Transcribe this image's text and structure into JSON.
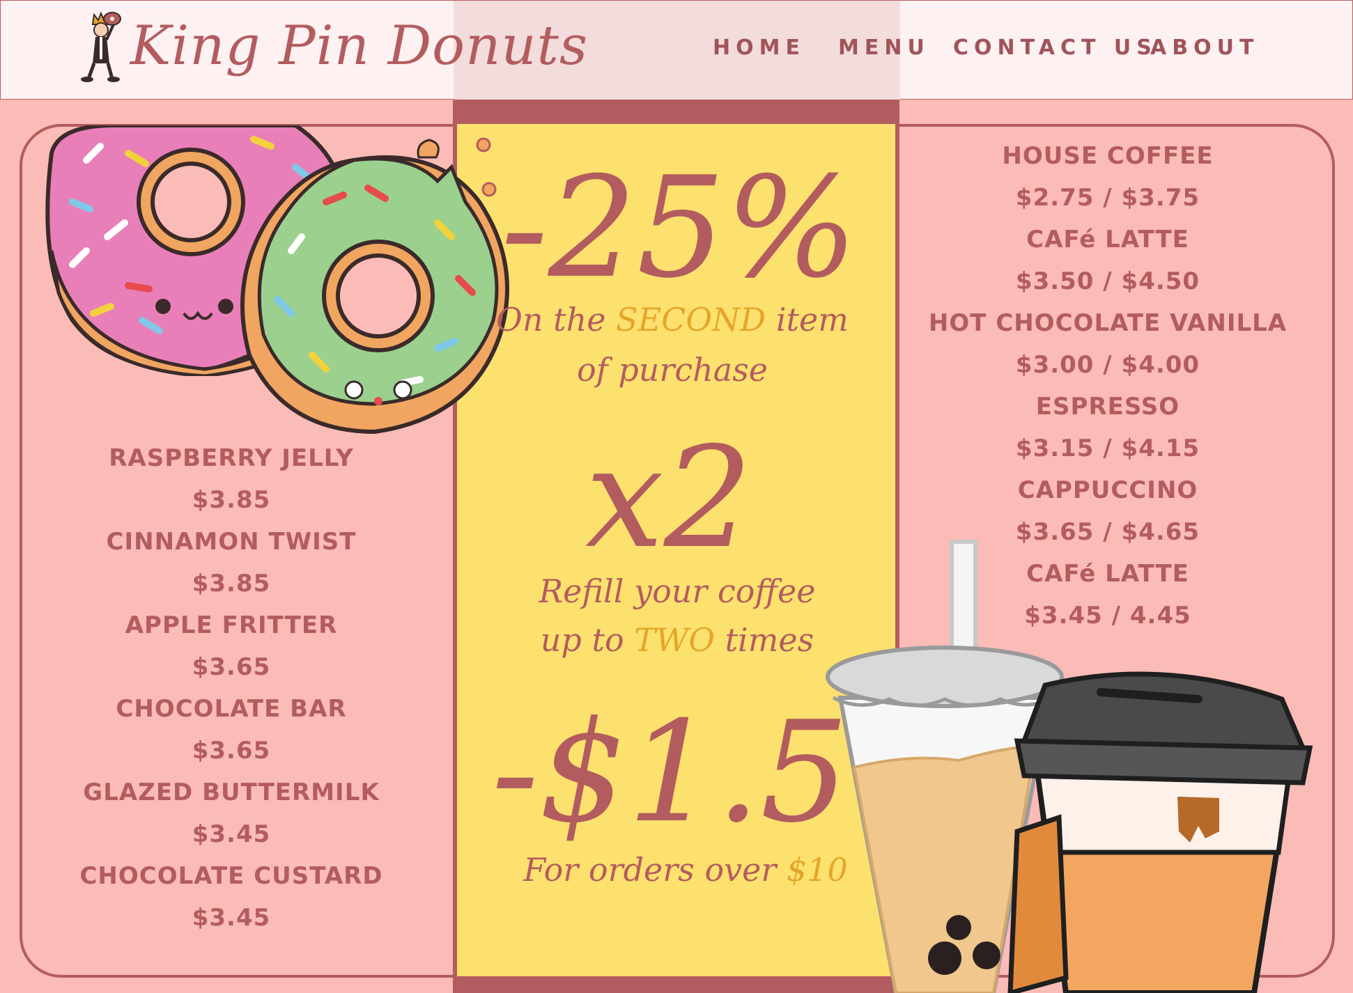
{
  "header": {
    "brand": "King Pin Donuts",
    "nav": [
      {
        "label": "HOME"
      },
      {
        "label": "MENU"
      },
      {
        "label": "CONTACT US"
      },
      {
        "label": "ABOUT"
      }
    ]
  },
  "donuts": [
    {
      "name": "RASPBERRY JELLY",
      "price": "$3.85"
    },
    {
      "name": "CINNAMON TWIST",
      "price": "$3.85"
    },
    {
      "name": "APPLE FRITTER",
      "price": "$3.65"
    },
    {
      "name": "CHOCOLATE  BAR",
      "price": "$3.65"
    },
    {
      "name": "GLAZED BUTTERMILK",
      "price": "$3.45"
    },
    {
      "name": "CHOCOLATE CUSTARD",
      "price": "$3.45"
    }
  ],
  "drinks": [
    {
      "name": "HOUSE COFFEE",
      "price": "$2.75 / $3.75"
    },
    {
      "name": "CAFé LATTE",
      "price": "$3.50 / $4.50"
    },
    {
      "name": "HOT CHOCOLATE VANILLA",
      "price": "$3.00 / $4.00"
    },
    {
      "name": "ESPRESSO",
      "price": "$3.15 / $4.15"
    },
    {
      "name": "CAPPUCCINO",
      "price": "$3.65 / $4.65"
    },
    {
      "name": "CAFé LATTE",
      "price": "$3.45 / 4.45"
    }
  ],
  "promos": {
    "discount": {
      "value": "-25%",
      "line1_pre": "On the ",
      "line1_hl": "SECOND",
      "line1_post": " item",
      "line2": "of purchase"
    },
    "refill": {
      "value": "x2",
      "line1": "Refill your coffee",
      "line2_pre": "up to ",
      "line2_hl": "TWO",
      "line2_post": " times"
    },
    "off": {
      "value": "-$1.5",
      "line1_pre": "For orders over ",
      "line1_hl": "$10"
    }
  },
  "colors": {
    "background": "#fbbbb7",
    "accent": "#b35c5f",
    "promo_panel": "#fde16e",
    "highlight": "#e5a52a"
  },
  "icons": [
    "king-mascot-icon",
    "pink-donut-icon",
    "green-donut-icon",
    "bubble-tea-icon",
    "coffee-cup-icon"
  ]
}
